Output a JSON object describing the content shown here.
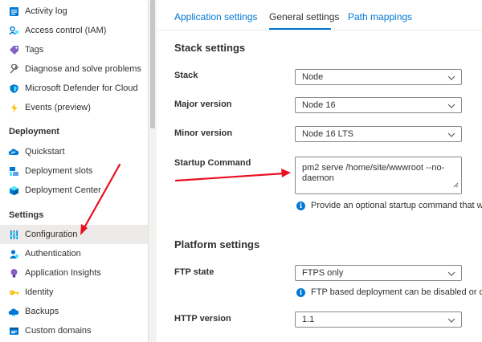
{
  "sidebar": {
    "items_top": [
      {
        "label": "Activity log",
        "icon": "activity-log-icon"
      },
      {
        "label": "Access control (IAM)",
        "icon": "access-control-icon"
      },
      {
        "label": "Tags",
        "icon": "tag-icon"
      },
      {
        "label": "Diagnose and solve problems",
        "icon": "wrench-icon"
      },
      {
        "label": "Microsoft Defender for Cloud",
        "icon": "shield-icon"
      },
      {
        "label": "Events (preview)",
        "icon": "lightning-icon"
      }
    ],
    "deployment_header": "Deployment",
    "deployment_items": [
      {
        "label": "Quickstart",
        "icon": "cloud-icon"
      },
      {
        "label": "Deployment slots",
        "icon": "deployment-slots-icon"
      },
      {
        "label": "Deployment Center",
        "icon": "cube-icon"
      }
    ],
    "settings_header": "Settings",
    "settings_items": [
      {
        "label": "Configuration",
        "icon": "sliders-icon",
        "active": true
      },
      {
        "label": "Authentication",
        "icon": "person-icon"
      },
      {
        "label": "Application Insights",
        "icon": "lightbulb-icon"
      },
      {
        "label": "Identity",
        "icon": "key-icon"
      },
      {
        "label": "Backups",
        "icon": "backup-cloud-icon"
      },
      {
        "label": "Custom domains",
        "icon": "domain-icon"
      }
    ]
  },
  "tabs": {
    "application_settings": "Application settings",
    "general_settings": "General settings",
    "path_mappings": "Path mappings",
    "active": "General settings"
  },
  "stack_settings": {
    "title": "Stack settings",
    "stack_label": "Stack",
    "stack_value": "Node",
    "major_label": "Major version",
    "major_value": "Node 16",
    "minor_label": "Minor version",
    "minor_value": "Node 16 LTS",
    "startup_label": "Startup Command",
    "startup_value_line1": "pm2 serve /home/site/wwwroot --no-",
    "startup_value_line2": "daemon",
    "startup_info": "Provide an optional startup command that will"
  },
  "platform_settings": {
    "title": "Platform settings",
    "ftp_label": "FTP state",
    "ftp_value": "FTPS only",
    "ftp_info": "FTP based deployment can be disabled or con",
    "http_label": "HTTP version",
    "http_value": "1.1"
  },
  "colors": {
    "accent": "#0078d4",
    "annotation_arrow": "#e81123",
    "active_nav_bg": "#edebe9"
  }
}
